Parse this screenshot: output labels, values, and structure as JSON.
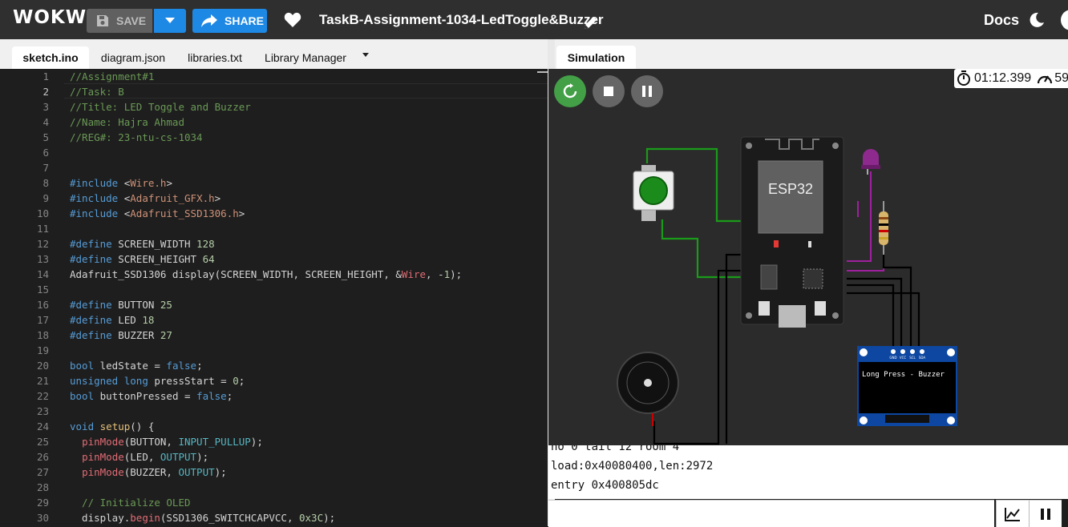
{
  "app": {
    "logo": "WOKWi"
  },
  "toolbar": {
    "save_label": "SAVE",
    "share_label": "SHARE",
    "project_title": "TaskB-Assignment-1034-LedToggle&Buzzer",
    "docs_label": "Docs",
    "colors": {
      "bar": "#2f2f2f",
      "accent": "#1e88e5",
      "save": "#606060"
    }
  },
  "editor": {
    "tabs": [
      "sketch.ino",
      "diagram.json",
      "libraries.txt",
      "Library Manager"
    ],
    "active_tab": "sketch.ino",
    "lines": [
      {
        "n": "1",
        "code": "//Assignment#1"
      },
      {
        "n": "2",
        "code": "//Task: B"
      },
      {
        "n": "3",
        "code": "//Title: LED Toggle and Buzzer"
      },
      {
        "n": "4",
        "code": "//Name: Hajra Ahmad"
      },
      {
        "n": "5",
        "code": "//REG#: 23-ntu-cs-1034"
      },
      {
        "n": "6",
        "code": ""
      },
      {
        "n": "7",
        "code": ""
      },
      {
        "n": "8",
        "code": "#include <Wire.h>"
      },
      {
        "n": "9",
        "code": "#include <Adafruit_GFX.h>"
      },
      {
        "n": "10",
        "code": "#include <Adafruit_SSD1306.h>"
      },
      {
        "n": "11",
        "code": ""
      },
      {
        "n": "12",
        "code": "#define SCREEN_WIDTH 128"
      },
      {
        "n": "13",
        "code": "#define SCREEN_HEIGHT 64"
      },
      {
        "n": "14",
        "code": "Adafruit_SSD1306 display(SCREEN_WIDTH, SCREEN_HEIGHT, &Wire, -1);"
      },
      {
        "n": "15",
        "code": ""
      },
      {
        "n": "16",
        "code": "#define BUTTON 25"
      },
      {
        "n": "17",
        "code": "#define LED 18"
      },
      {
        "n": "18",
        "code": "#define BUZZER 27"
      },
      {
        "n": "19",
        "code": ""
      },
      {
        "n": "20",
        "code": "bool ledState = false;"
      },
      {
        "n": "21",
        "code": "unsigned long pressStart = 0;"
      },
      {
        "n": "22",
        "code": "bool buttonPressed = false;"
      },
      {
        "n": "23",
        "code": ""
      },
      {
        "n": "24",
        "code": "void setup() {"
      },
      {
        "n": "25",
        "code": "  pinMode(BUTTON, INPUT_PULLUP);"
      },
      {
        "n": "26",
        "code": "  pinMode(LED, OUTPUT);"
      },
      {
        "n": "27",
        "code": "  pinMode(BUZZER, OUTPUT);"
      },
      {
        "n": "28",
        "code": ""
      },
      {
        "n": "29",
        "code": "  // Initialize OLED"
      },
      {
        "n": "30",
        "code": "  display.begin(SSD1306_SWITCHCAPVCC, 0x3C);"
      }
    ],
    "current_line": "2"
  },
  "simulation": {
    "tab_label": "Simulation",
    "timer": "01:12.399",
    "speed": "59",
    "board_label": "ESP32",
    "oled_text": "Long Press - Buzzer",
    "oled_pins": [
      "GND",
      "VCC",
      "SCL",
      "SDA"
    ],
    "icons": [
      "restart-icon",
      "stop-icon",
      "pause-icon",
      "stopwatch-icon",
      "speedometer-icon"
    ]
  },
  "serial": {
    "lines": [
      "ho 0 tail 12 room 4",
      "load:0x40080400,len:2972",
      "entry 0x400805dc"
    ],
    "icons": [
      "chart-icon",
      "pause-icon"
    ]
  }
}
